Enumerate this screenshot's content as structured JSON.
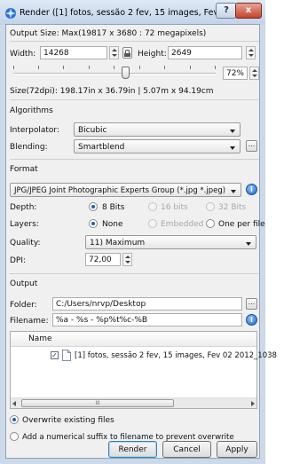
{
  "window": {
    "title": "Render ([1] fotos, sessão 2 fev, 15 images, Fev 02 ...",
    "help_glyph": "?",
    "close_glyph": "x"
  },
  "output_size": {
    "label": "Output Size: Max(19817 x 3680 : 72 megapixels)"
  },
  "width": {
    "label": "Width:",
    "value": "14268"
  },
  "height": {
    "label": "Height:",
    "value": "2649"
  },
  "scale": {
    "percent_text": "72%",
    "percent": 72
  },
  "size_info": {
    "text": "Size(72dpi): 198.17in x 36.79in  |  5.07m x 94.19cm"
  },
  "algorithms": {
    "header": "Algorithms",
    "interpolator_label": "Interpolator:",
    "interpolator_value": "Bicubic",
    "blending_label": "Blending:",
    "blending_value": "Smartblend",
    "blending_more": "..."
  },
  "format": {
    "header": "Format",
    "type_value": "JPG/JPEG Joint Photographic Experts Group (*.jpg *.jpeg)",
    "depth_label": "Depth:",
    "depth_options": [
      "8 Bits",
      "16 bits",
      "32 Bits"
    ],
    "layers_label": "Layers:",
    "layers_options": [
      "None",
      "Embedded",
      "One per file"
    ],
    "quality_label": "Quality:",
    "quality_value": "11) Maximum",
    "dpi_label": "DPI:",
    "dpi_value": "72,00"
  },
  "output": {
    "header": "Output",
    "folder_label": "Folder:",
    "folder_value": "C:/Users/nrvp/Desktop",
    "folder_more": "...",
    "filename_label": "Filename:",
    "filename_value": "%a - %s - %p%t%c-%B",
    "list_header": "Name",
    "list_item": "[1] fotos, sessão 2 fev, 15 images, Fev 02 2012_1038",
    "scroll_glyph": "III",
    "overwrite_label": "Overwrite existing files",
    "suffix_label": "Add a numerical suffix to filename to prevent overwrite"
  },
  "buttons": {
    "render": "Render",
    "cancel": "Cancel",
    "apply": "Apply"
  }
}
